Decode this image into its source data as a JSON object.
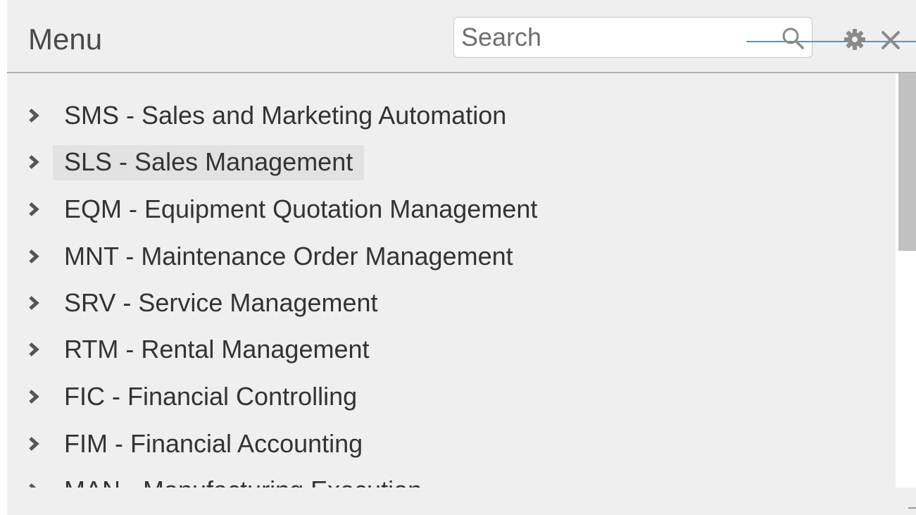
{
  "header": {
    "title": "Menu",
    "search_placeholder": "Search",
    "search_value": ""
  },
  "icons": {
    "search": "search-icon",
    "settings": "gear-icon",
    "close": "close-icon",
    "expand": "chevron-right-icon"
  },
  "colors": {
    "accent": "#2aa6d4",
    "panel_background": "#efefef",
    "highlight": "#e2e2e2",
    "text": "#333333"
  },
  "menu": {
    "highlighted_index": 1,
    "items": [
      {
        "label": "SMS - Sales and Marketing Automation"
      },
      {
        "label": "SLS - Sales Management"
      },
      {
        "label": "EQM - Equipment Quotation Management"
      },
      {
        "label": "MNT - Maintenance Order Management"
      },
      {
        "label": "SRV - Service Management"
      },
      {
        "label": "RTM - Rental Management"
      },
      {
        "label": "FIC - Financial Controlling"
      },
      {
        "label": "FIM - Financial Accounting"
      },
      {
        "label": "MAN - Manufacturing Execution"
      }
    ]
  }
}
